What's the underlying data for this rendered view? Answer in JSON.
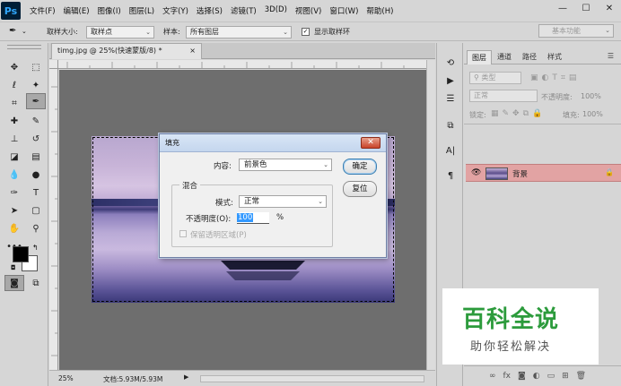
{
  "app": {
    "logo": "Ps"
  },
  "menu": [
    "文件(F)",
    "编辑(E)",
    "图像(I)",
    "图层(L)",
    "文字(Y)",
    "选择(S)",
    "滤镜(T)",
    "3D(D)",
    "视图(V)",
    "窗口(W)",
    "帮助(H)"
  ],
  "window_controls": {
    "minimize": "—",
    "maximize": "☐",
    "close": "✕"
  },
  "options_bar": {
    "sample_size_label": "取样大小:",
    "sample_size_value": "取样点",
    "sample_label": "样本:",
    "sample_value": "所有图层",
    "show_ring_label": "显示取样环",
    "show_ring_checked": true,
    "workspace": "基本功能"
  },
  "document": {
    "tab_title": "timg.jpg @ 25%(快速蒙版/8) *",
    "tab_close": "×",
    "zoom": "25%",
    "doc_info": "文档:5.93M/5.93M"
  },
  "fill_dialog": {
    "title": "填充",
    "content_label": "内容:",
    "content_value": "前景色",
    "blend_group_label": "混合",
    "mode_label": "模式:",
    "mode_value": "正常",
    "opacity_label": "不透明度(O):",
    "opacity_value": "100",
    "opacity_unit": "%",
    "preserve_label": "保留透明区域(P)",
    "ok_label": "确定",
    "reset_label": "复位",
    "close_glyph": "✕"
  },
  "layers_panel": {
    "tabs": [
      "图层",
      "通道",
      "路径",
      "样式"
    ],
    "active_tab": 0,
    "kind_label": "类型",
    "blend_mode": "正常",
    "opacity_label": "不透明度:",
    "opacity_value": "100%",
    "lock_label": "锁定:",
    "fill_label": "填充:",
    "fill_value": "100%",
    "layers": [
      {
        "name": "背景",
        "visible": true,
        "locked": true
      }
    ],
    "footer_icons": [
      "link-icon",
      "fx-icon",
      "mask-icon",
      "adjustment-icon",
      "group-icon",
      "new-layer-icon",
      "delete-icon"
    ]
  },
  "colors": {
    "foreground": "#000000",
    "background": "#ffffff",
    "layer_selected": "#e2a3a3",
    "accent": "#3399ff"
  },
  "watermark": {
    "title": "百科全说",
    "subtitle": "助你轻松解决"
  }
}
